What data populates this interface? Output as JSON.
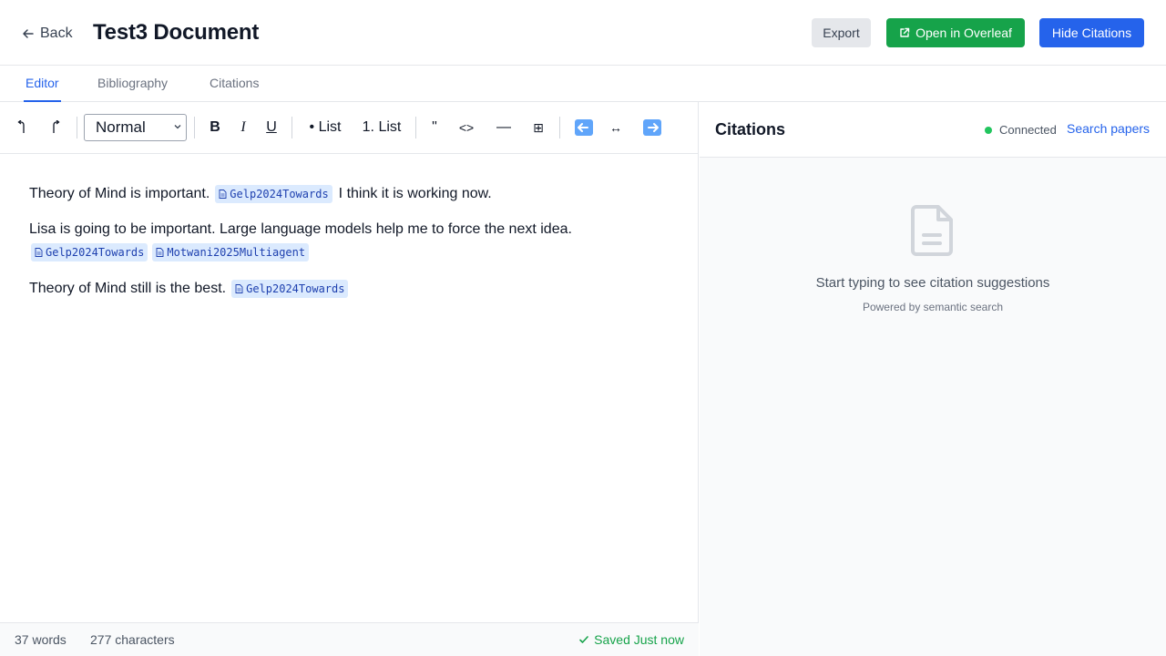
{
  "header": {
    "back_label": "Back",
    "title": "Test3 Document",
    "export_label": "Export",
    "overleaf_label": "Open in Overleaf",
    "hide_citations_label": "Hide Citations"
  },
  "tabs": [
    {
      "label": "Editor",
      "active": true
    },
    {
      "label": "Bibliography",
      "active": false
    },
    {
      "label": "Citations",
      "active": false
    }
  ],
  "toolbar": {
    "undo_icon": "undo-icon",
    "redo_icon": "redo-icon",
    "style_select": "Normal",
    "bold": "B",
    "italic": "I",
    "underline": "U",
    "bullet_list": "• List",
    "numbered_list": "1. List",
    "quote": "\"",
    "code": "<>",
    "hr": "—",
    "table": "⊞",
    "align_left": "⬅️",
    "align_center": "↔",
    "align_right": "➡️"
  },
  "document": {
    "paragraphs": [
      {
        "text": "Theory of Mind is important.",
        "citations": [
          "Gelp2024Towards"
        ],
        "after": "I think it is working now."
      },
      {
        "text": "Lisa is going to be important. Large language models help me to force the next idea.",
        "citations": [
          "Gelp2024Towards",
          "Motwani2025Multiagent"
        ]
      },
      {
        "text": "Theory of Mind still is the best.",
        "citations": [
          "Gelp2024Towards"
        ]
      }
    ]
  },
  "status": {
    "words": "37 words",
    "characters": "277 characters",
    "saved": "Saved Just now"
  },
  "citations_panel": {
    "title": "Citations",
    "connection": "Connected",
    "search_link": "Search papers",
    "empty_message": "Start typing to see citation suggestions",
    "empty_sub": "Powered by semantic search"
  },
  "colors": {
    "primary": "#2563eb",
    "success": "#16a34a",
    "chip_bg": "#dbeafe",
    "chip_text": "#1e40af"
  }
}
